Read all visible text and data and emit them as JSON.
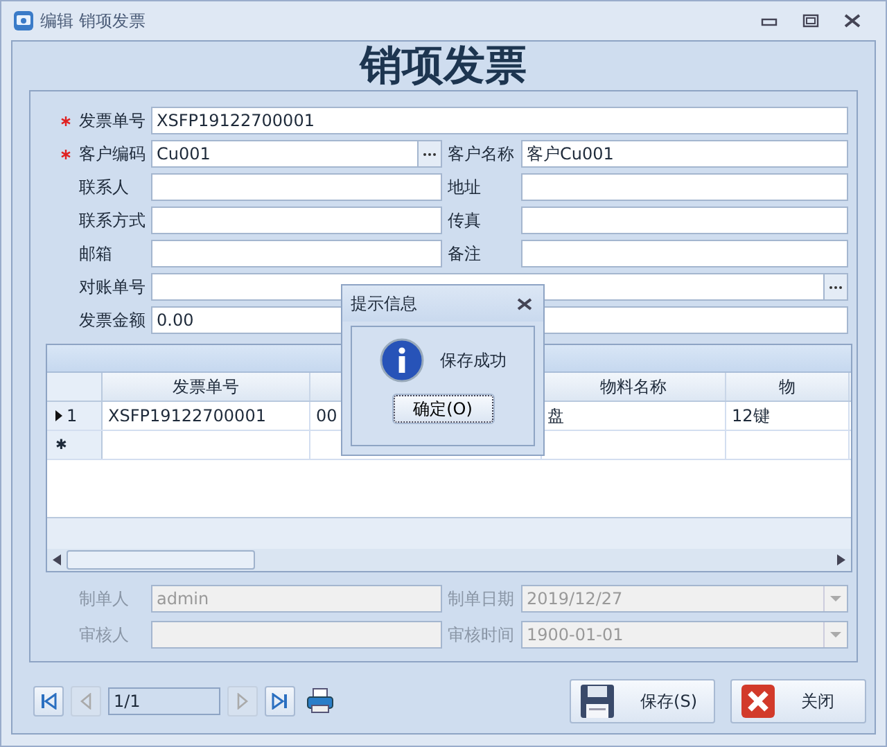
{
  "window": {
    "title": "编辑 销项发票"
  },
  "heading": "销项发票",
  "form": {
    "rows": [
      {
        "fields": [
          {
            "label": "发票单号",
            "value": "XSFP19122700001",
            "required": true,
            "kind": "text"
          }
        ]
      },
      {
        "fields": [
          {
            "label": "客户编码",
            "value": "Cu001",
            "required": true,
            "kind": "lookup"
          },
          {
            "label": "客户名称",
            "value": "客户Cu001",
            "required": false,
            "kind": "text"
          }
        ]
      },
      {
        "fields": [
          {
            "label": "联系人",
            "required": false,
            "kind": "text"
          },
          {
            "label": "地址",
            "required": false,
            "kind": "text"
          }
        ]
      },
      {
        "fields": [
          {
            "label": "联系方式",
            "required": false,
            "kind": "text"
          },
          {
            "label": "传真",
            "required": false,
            "kind": "text"
          }
        ]
      },
      {
        "fields": [
          {
            "label": "邮箱",
            "required": false,
            "kind": "text"
          },
          {
            "label": "备注",
            "required": false,
            "kind": "text"
          }
        ]
      },
      {
        "fields": [
          {
            "label": "对账单号",
            "required": false,
            "kind": "lookup"
          }
        ]
      },
      {
        "fields": [
          {
            "label": "发票金额",
            "value": "0.00",
            "required": false,
            "kind": "text"
          }
        ]
      }
    ]
  },
  "grid": {
    "columns": [
      {
        "label": "发票单号"
      },
      {},
      {
        "label": "物料名称"
      },
      {
        "label": "物"
      }
    ],
    "rows": [
      {
        "kind": "data",
        "current": true,
        "number": "1",
        "cells": [
          "XSFP19122700001",
          "00",
          "盘",
          "12键"
        ]
      },
      {
        "kind": "new",
        "current": false,
        "marker": "✱",
        "cells": []
      }
    ]
  },
  "audit": {
    "rows": [
      {
        "fields": [
          {
            "label": "制单人",
            "value": "admin",
            "kind": "text",
            "disabled": true
          },
          {
            "label": "制单日期",
            "value": "2019/12/27",
            "kind": "date",
            "disabled": true
          }
        ]
      },
      {
        "fields": [
          {
            "label": "审核人",
            "kind": "text",
            "disabled": true
          },
          {
            "label": "审核时间",
            "value": "1900-01-01",
            "kind": "date",
            "disabled": true
          }
        ]
      }
    ]
  },
  "navigator": {
    "first_disabled": false,
    "prev_disabled": true,
    "position": "1/1",
    "next_disabled": true,
    "last_disabled": false
  },
  "buttons": [
    {
      "kind": "save",
      "label": "保存(S)"
    },
    {
      "kind": "close",
      "label": "关闭"
    }
  ],
  "dialog": {
    "title": "提示信息",
    "message": "保存成功",
    "button": "确定(O)"
  }
}
